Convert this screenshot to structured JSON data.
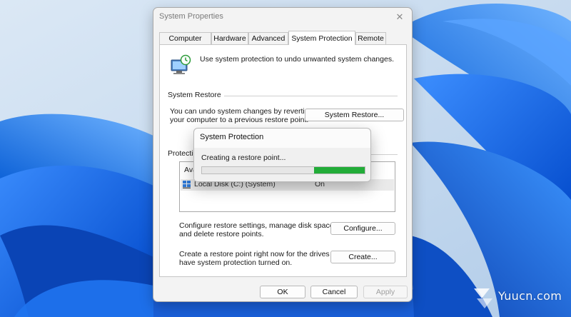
{
  "window": {
    "title": "System Properties",
    "close_glyph": "✕"
  },
  "tabs": [
    {
      "label": "Computer Name",
      "active": false
    },
    {
      "label": "Hardware",
      "active": false
    },
    {
      "label": "Advanced",
      "active": false
    },
    {
      "label": "System Protection",
      "active": true
    },
    {
      "label": "Remote",
      "active": false
    }
  ],
  "panel": {
    "intro": "Use system protection to undo unwanted system changes.",
    "system_restore": {
      "label": "System Restore",
      "description_line1": "You can undo system changes by reverting",
      "description_line2": "your computer to a previous restore point.",
      "button": "System Restore..."
    },
    "protection_settings": {
      "label": "Protection Settings",
      "list_header": "Available Drives",
      "drive_name": "Local Disk (C:) (System)",
      "drive_status": "On"
    },
    "configure": {
      "line1": "Configure restore settings, manage disk space,",
      "line2": "and delete restore points.",
      "button": "Configure..."
    },
    "create": {
      "line1": "Create a restore point right now for the drives that",
      "line2": "have system protection turned on.",
      "button": "Create..."
    }
  },
  "footer": {
    "ok": "OK",
    "cancel": "Cancel",
    "apply": "Apply"
  },
  "progress_dialog": {
    "title": "System Protection",
    "message": "Creating a restore point...",
    "indeterminate_segment": {
      "start": 0.69,
      "end": 1.0
    }
  },
  "watermark": {
    "text": "Yuucn.com"
  },
  "colors": {
    "progress": "#22ac38",
    "wallpaper_blue": "#0a5fd6"
  }
}
